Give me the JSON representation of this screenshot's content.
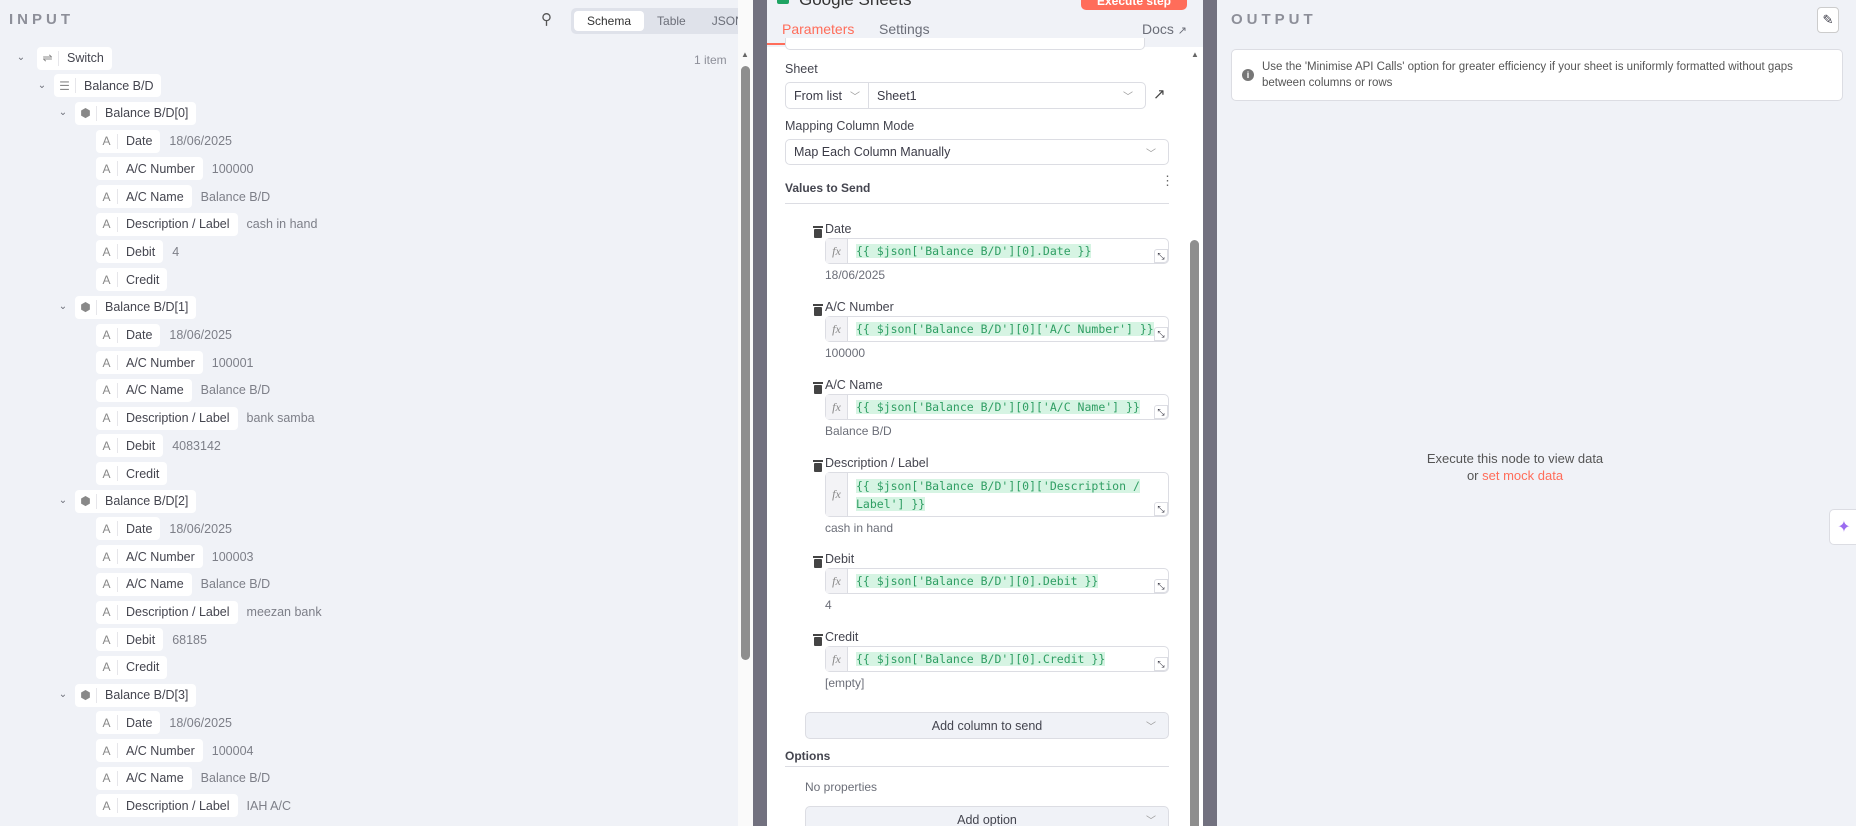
{
  "input": {
    "title": "INPUT",
    "views": [
      "Schema",
      "Table",
      "JSON"
    ],
    "active_view": "Schema",
    "root": {
      "label": "Switch",
      "count": "1 item"
    },
    "array_label": "Balance B/D",
    "items": [
      {
        "label": "Balance B/D[0]",
        "fields": [
          [
            "Date",
            "18/06/2025"
          ],
          [
            "A/C Number",
            "100000"
          ],
          [
            "A/C Name",
            "Balance B/D"
          ],
          [
            "Description / Label",
            "cash in hand"
          ],
          [
            "Debit",
            "4"
          ],
          [
            "Credit",
            ""
          ]
        ]
      },
      {
        "label": "Balance B/D[1]",
        "fields": [
          [
            "Date",
            "18/06/2025"
          ],
          [
            "A/C Number",
            "100001"
          ],
          [
            "A/C Name",
            "Balance B/D"
          ],
          [
            "Description / Label",
            "bank samba"
          ],
          [
            "Debit",
            "4083142"
          ],
          [
            "Credit",
            ""
          ]
        ]
      },
      {
        "label": "Balance B/D[2]",
        "fields": [
          [
            "Date",
            "18/06/2025"
          ],
          [
            "A/C Number",
            "100003"
          ],
          [
            "A/C Name",
            "Balance B/D"
          ],
          [
            "Description / Label",
            "meezan bank"
          ],
          [
            "Debit",
            "68185"
          ],
          [
            "Credit",
            ""
          ]
        ]
      },
      {
        "label": "Balance B/D[3]",
        "fields": [
          [
            "Date",
            "18/06/2025"
          ],
          [
            "A/C Number",
            "100004"
          ],
          [
            "A/C Name",
            "Balance B/D"
          ],
          [
            "Description / Label",
            "IAH A/C"
          ]
        ]
      }
    ]
  },
  "node": {
    "title": "Google Sheets",
    "execute_label": "Execute step",
    "tabs": [
      "Parameters",
      "Settings"
    ],
    "active_tab": "Parameters",
    "docs": "Docs",
    "sheet": {
      "label": "Sheet",
      "mode": "From list",
      "value": "Sheet1"
    },
    "mapping": {
      "label": "Mapping Column Mode",
      "value": "Map Each Column Manually"
    },
    "values_title": "Values to Send",
    "columns": [
      {
        "name": "Date",
        "expr": "{{ $json['Balance B/D'][0].Date }}",
        "result": "18/06/2025"
      },
      {
        "name": "A/C Number",
        "expr": "{{ $json['Balance B/D'][0]['A/C Number'] }}",
        "result": "100000"
      },
      {
        "name": "A/C Name",
        "expr": "{{ $json['Balance B/D'][0]['A/C Name'] }}",
        "result": "Balance B/D"
      },
      {
        "name": "Description / Label",
        "expr": "{{ $json['Balance B/D'][0]['Description / Label'] }}",
        "result": "cash in hand"
      },
      {
        "name": "Debit",
        "expr": "{{ $json['Balance B/D'][0].Debit }}",
        "result": "4"
      },
      {
        "name": "Credit",
        "expr": "{{ $json['Balance B/D'][0].Credit }}",
        "result": "[empty]"
      }
    ],
    "add_column": "Add column to send",
    "options_title": "Options",
    "no_props": "No properties",
    "add_option": "Add option"
  },
  "output": {
    "title": "OUTPUT",
    "notice": "Use the 'Minimise API Calls' option for greater efficiency if your sheet is uniformly formatted without gaps between columns or rows",
    "empty_line1": "Execute this node to view data",
    "empty_or": "or",
    "mock_link": "set mock data"
  },
  "colors": {
    "accent": "#ff6d5a",
    "expr": "#2f9e63"
  }
}
